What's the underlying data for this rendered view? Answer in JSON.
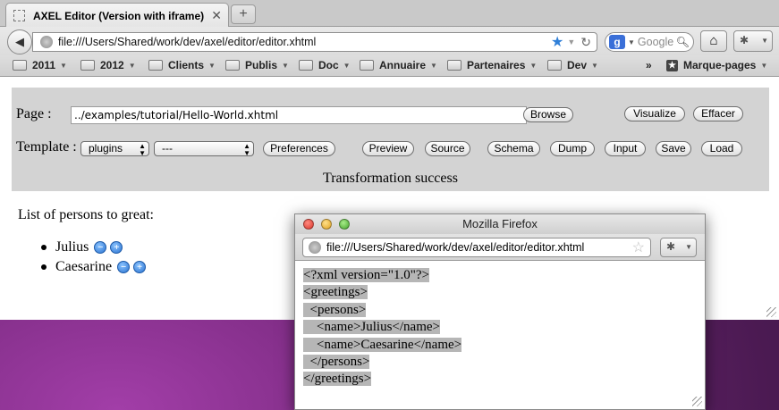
{
  "browser": {
    "tab_title": "AXEL Editor (Version with iframe)",
    "tab_close": "✕",
    "new_tab": "+",
    "url": "file:///Users/Shared/work/dev/axel/editor/editor.xhtml",
    "search_placeholder": "Google",
    "bookmarks": [
      "2011",
      "2012",
      "Clients",
      "Publis",
      "Doc",
      "Annuaire",
      "Partenaires",
      "Dev"
    ],
    "bookmarks_overflow": "»",
    "bookmarks_menu": "Marque-pages"
  },
  "editor": {
    "page_label": "Page :",
    "page_value": "../examples/tutorial/Hello-World.xhtml",
    "browse": "Browse",
    "visualize": "Visualize",
    "clear": "Effacer",
    "template_label": "Template :",
    "template_select": "plugins",
    "template_select2": "---",
    "preferences": "Preferences",
    "preview": "Preview",
    "source": "Source",
    "schema": "Schema",
    "dump": "Dump",
    "input": "Input",
    "save": "Save",
    "load": "Load",
    "status": "Transformation success"
  },
  "document": {
    "heading": "List of persons to great:",
    "persons": [
      "Julius",
      "Caesarine"
    ]
  },
  "popup": {
    "title": "Mozilla Firefox",
    "url": "file:///Users/Shared/work/dev/axel/editor/editor.xhtml",
    "xml_lines": [
      "<?xml version=\"1.0\"?>",
      "<greetings>",
      "  <persons>",
      "    <name>Julius</name>",
      "    <name>Caesarine</name>",
      "  </persons>",
      "</greetings>"
    ]
  },
  "colors": {
    "panel": "#d3d3d3",
    "accent_blue": "#2f7fd8",
    "desktop": "#7a2a80"
  }
}
